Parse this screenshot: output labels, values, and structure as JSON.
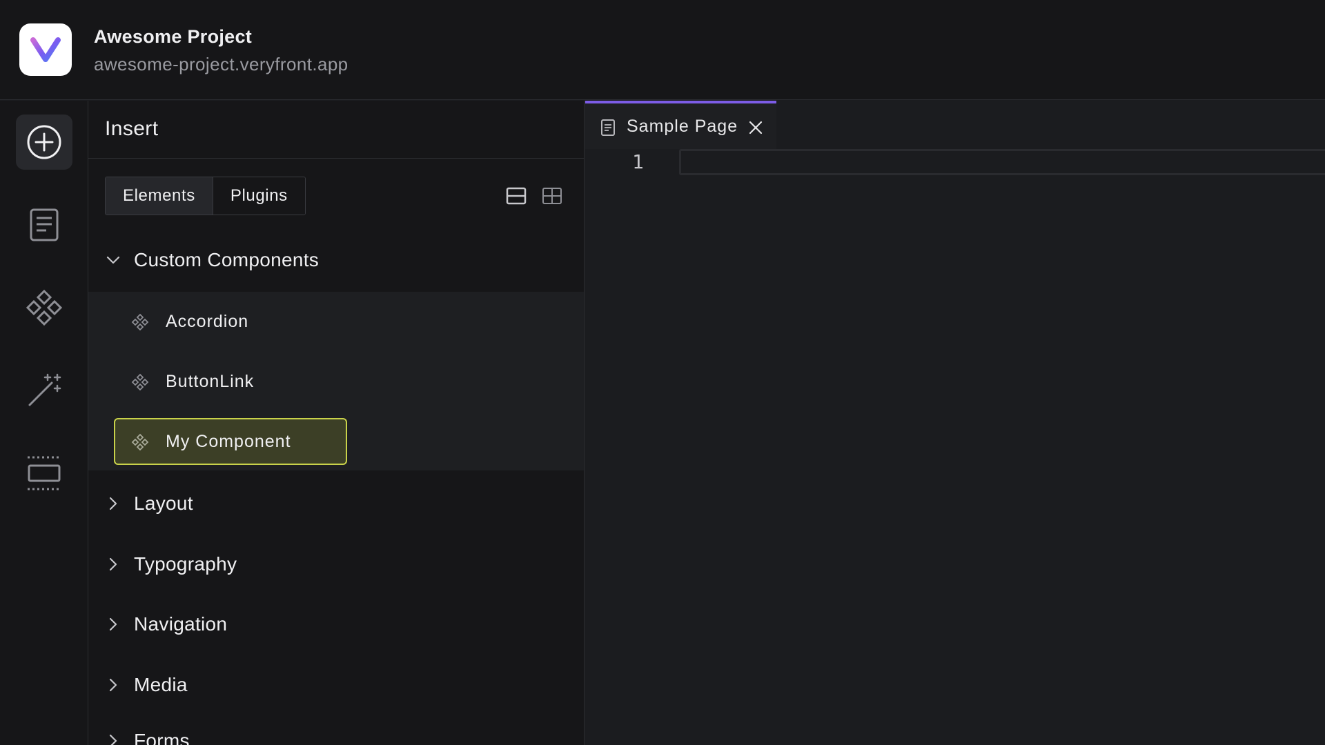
{
  "header": {
    "project_name": "Awesome Project",
    "project_url": "awesome-project.veryfront.app",
    "logo_icon": "veryfront-logo"
  },
  "rail": {
    "items": [
      {
        "icon": "add-circle-icon",
        "active": true
      },
      {
        "icon": "page-icon",
        "active": false
      },
      {
        "icon": "components-icon",
        "active": false
      },
      {
        "icon": "magic-wand-icon",
        "active": false
      },
      {
        "icon": "section-icon",
        "active": false
      }
    ]
  },
  "insert_panel": {
    "title": "Insert",
    "tabs": [
      {
        "label": "Elements",
        "selected": true
      },
      {
        "label": "Plugins",
        "selected": false
      }
    ],
    "view_toggles": [
      "list-view-icon",
      "grid-view-icon"
    ],
    "sections": [
      {
        "label": "Custom Components",
        "expanded": true,
        "items": [
          {
            "label": "Accordion",
            "selected": false
          },
          {
            "label": "ButtonLink",
            "selected": false
          },
          {
            "label": "My Component",
            "selected": true
          }
        ]
      },
      {
        "label": "Layout",
        "expanded": false
      },
      {
        "label": "Typography",
        "expanded": false
      },
      {
        "label": "Navigation",
        "expanded": false
      },
      {
        "label": "Media",
        "expanded": false
      },
      {
        "label": "Forms",
        "expanded": false
      }
    ]
  },
  "editor": {
    "tab_label": "Sample Page",
    "line_numbers": [
      "1"
    ]
  },
  "colors": {
    "accent": "#7c5ce6",
    "selection_bg": "#3c3f26",
    "selection_border": "#c9d24a",
    "background": "#161618"
  }
}
